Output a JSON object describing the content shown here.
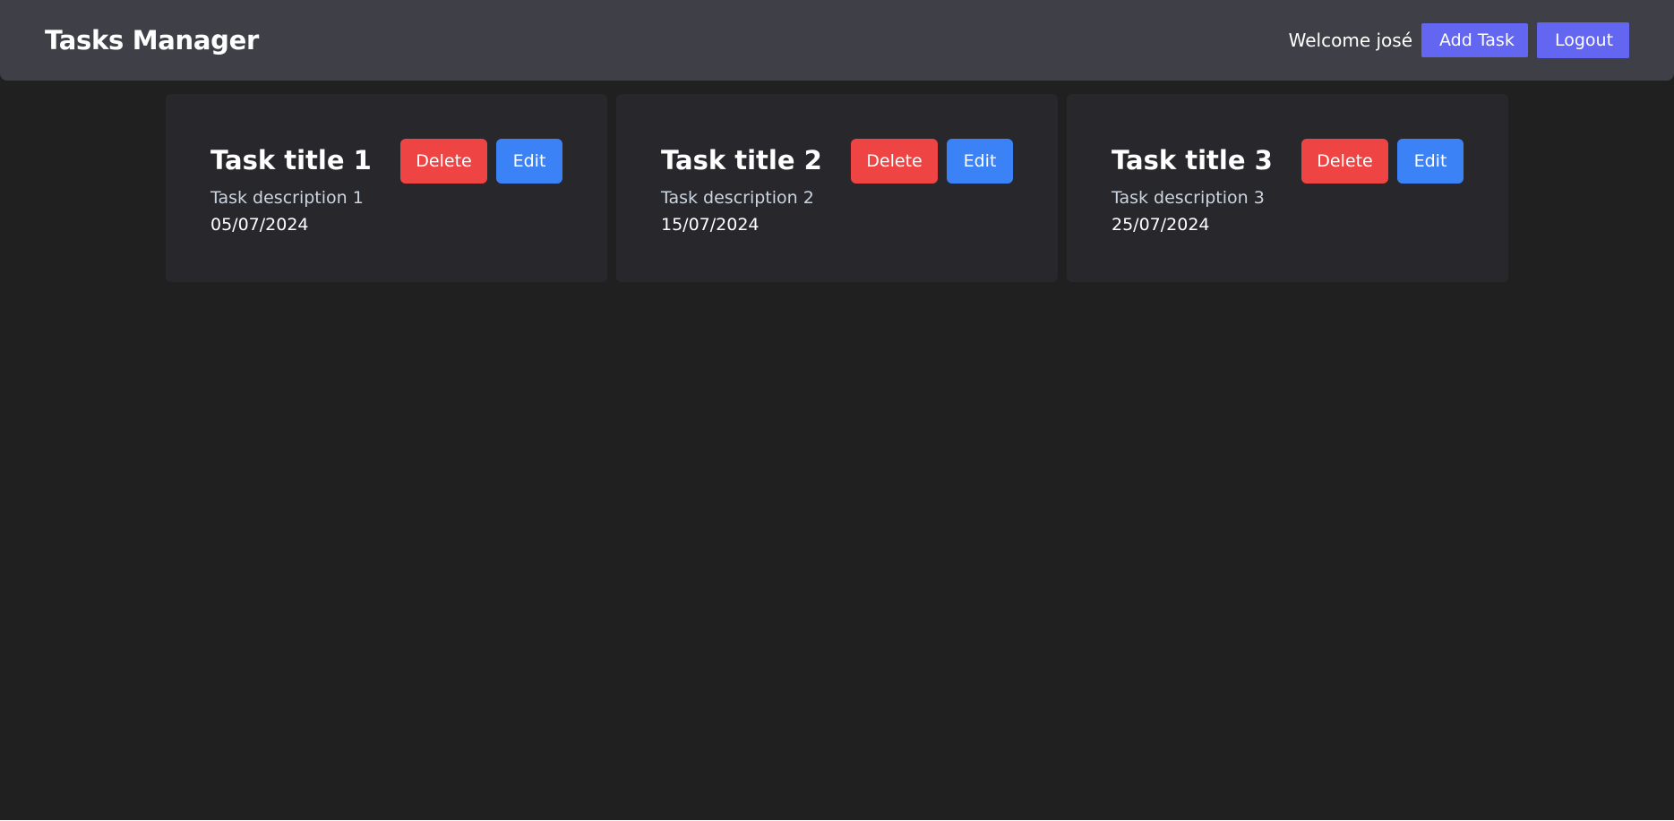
{
  "header": {
    "title": "Tasks Manager",
    "welcome": "Welcome josé",
    "add_task_label": "Add Task",
    "logout_label": "Logout"
  },
  "tasks": [
    {
      "title": "Task title 1",
      "description": "Task description 1",
      "date": "05/07/2024",
      "delete_label": "Delete",
      "edit_label": "Edit"
    },
    {
      "title": "Task title 2",
      "description": "Task description 2",
      "date": "15/07/2024",
      "delete_label": "Delete",
      "edit_label": "Edit"
    },
    {
      "title": "Task title 3",
      "description": "Task description 3",
      "date": "25/07/2024",
      "delete_label": "Delete",
      "edit_label": "Edit"
    }
  ],
  "colors": {
    "background": "#202020",
    "navbar": "#3f4047",
    "card": "#28282c",
    "primary": "#6366f1",
    "delete": "#ef4444",
    "edit": "#3b82f6"
  }
}
